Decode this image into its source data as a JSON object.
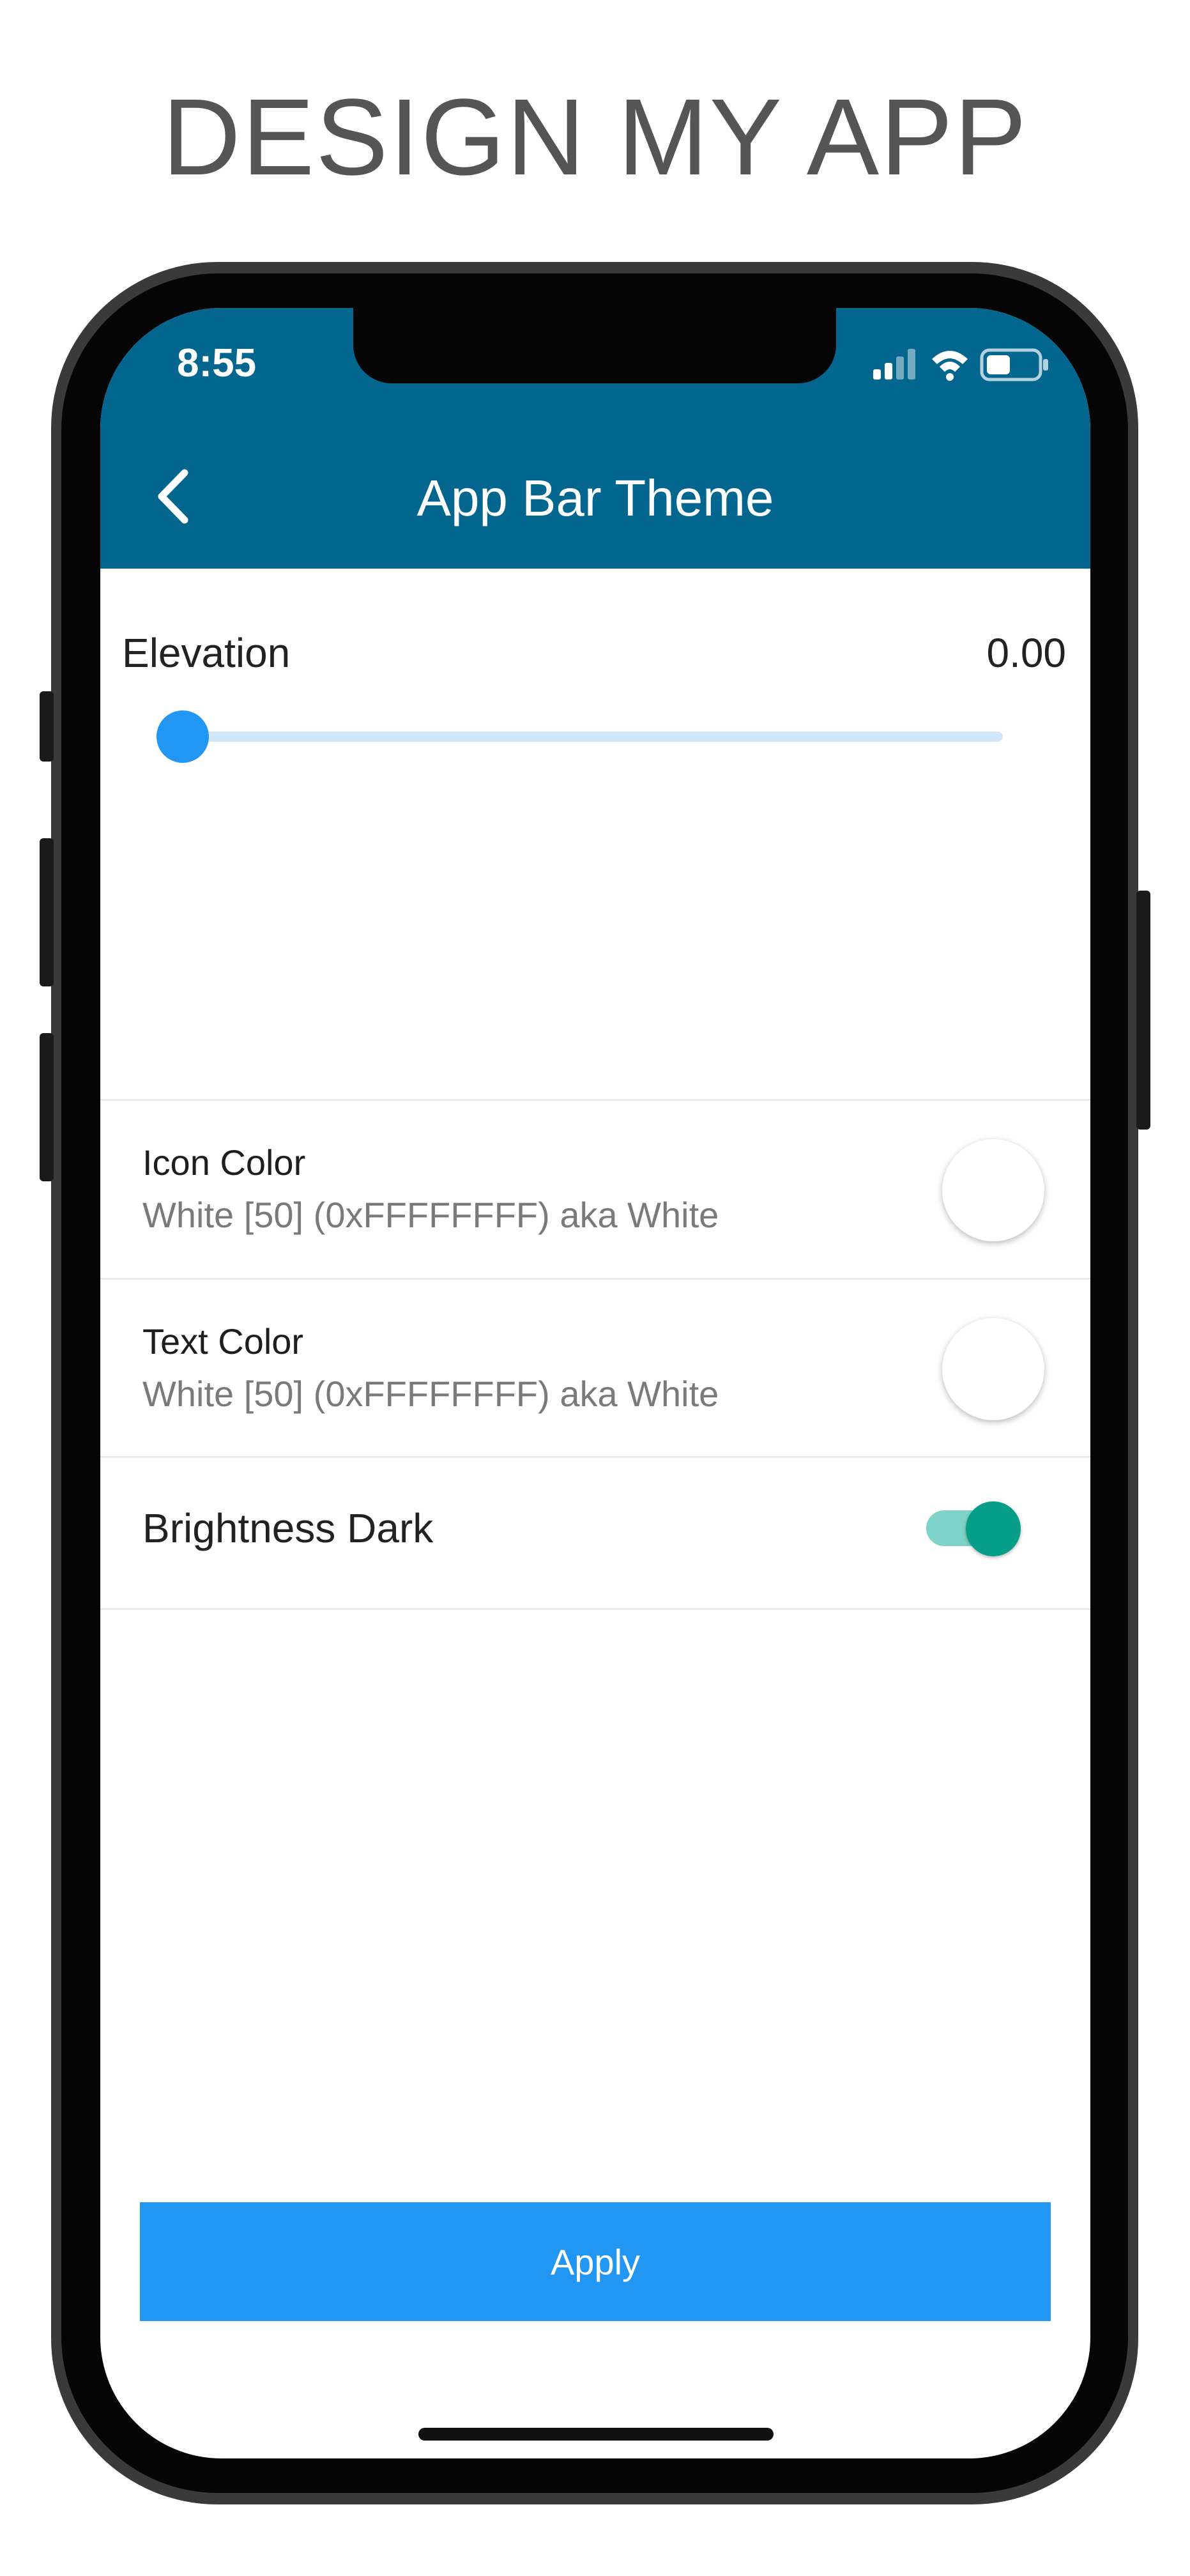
{
  "headline": "DESIGN MY APP",
  "status_bar": {
    "time": "8:55",
    "icons": [
      "signal-icon",
      "wifi-icon",
      "battery-icon"
    ]
  },
  "app_bar": {
    "title": "App Bar Theme",
    "back_icon": "chevron-left-icon",
    "background_color": "#03668f"
  },
  "elevation": {
    "label": "Elevation",
    "value_text": "0.00",
    "value": 0.0
  },
  "icon_color": {
    "title": "Icon Color",
    "subtitle": "White [50] (0xFFFFFFFF) aka White",
    "swatch_color": "#ffffff"
  },
  "text_color": {
    "title": "Text Color",
    "subtitle": "White [50] (0xFFFFFFFF) aka White",
    "swatch_color": "#ffffff"
  },
  "brightness": {
    "label": "Brightness Dark",
    "enabled": true,
    "accent_color": "#069e88"
  },
  "apply_button": {
    "label": "Apply",
    "color": "#2196f3"
  }
}
